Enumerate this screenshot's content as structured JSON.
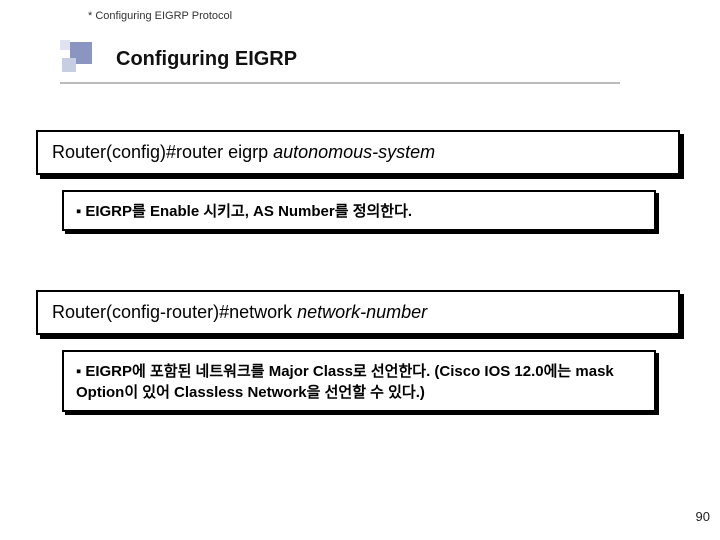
{
  "header": {
    "kicker": "* Configuring EIGRP Protocol",
    "title": "Configuring EIGRP"
  },
  "blocks": {
    "cmd1_prompt": "Router(config)#router eigrp ",
    "cmd1_arg": "autonomous-system",
    "desc1": "EIGRP를 Enable 시키고, AS Number를 정의한다.",
    "cmd2_prompt": "Router(config-router)#network ",
    "cmd2_arg": "network-number",
    "desc2": "EIGRP에 포함된 네트워크를 Major Class로 선언한다. (Cisco IOS 12.0에는 mask Option이 있어 Classless Network을 선언할 수 있다.)"
  },
  "bullet": "▪",
  "page_number": "90"
}
